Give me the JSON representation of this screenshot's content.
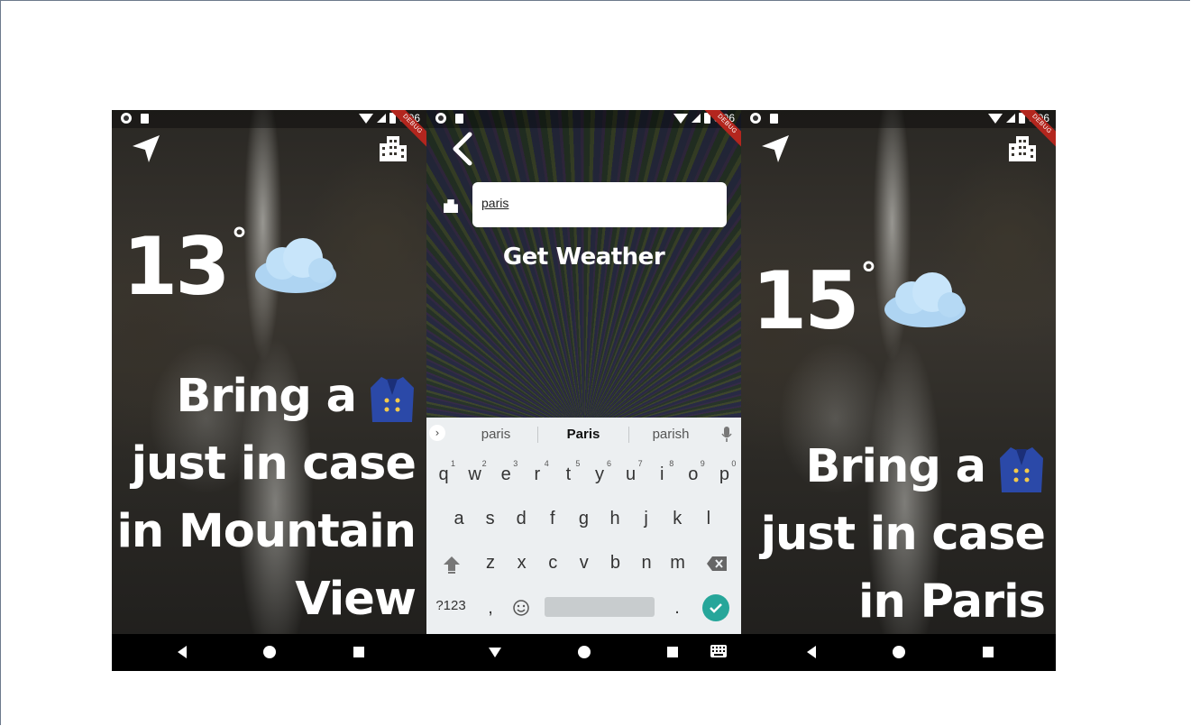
{
  "status": {
    "time": "6:06",
    "debug_label": "DEBUG"
  },
  "screens": {
    "weather_1": {
      "temperature": "13",
      "degree": "°",
      "message_lines": [
        "Bring a",
        "just in case",
        "in Mountain",
        "View"
      ]
    },
    "search": {
      "input_value": "paris",
      "button_label": "Get Weather",
      "suggestions": [
        "paris",
        "Paris",
        "parish"
      ],
      "keyboard": {
        "row1": [
          "q",
          "w",
          "e",
          "r",
          "t",
          "y",
          "u",
          "i",
          "o",
          "p"
        ],
        "row1_hints": [
          "1",
          "2",
          "3",
          "4",
          "5",
          "6",
          "7",
          "8",
          "9",
          "0"
        ],
        "row2": [
          "a",
          "s",
          "d",
          "f",
          "g",
          "h",
          "j",
          "k",
          "l"
        ],
        "row3": [
          "z",
          "x",
          "c",
          "v",
          "b",
          "n",
          "m"
        ],
        "symbols_key": "?123",
        "comma_key": ",",
        "period_key": "."
      }
    },
    "weather_3": {
      "temperature": "15",
      "degree": "°",
      "message_lines": [
        "Bring a",
        "just in case",
        "in Paris"
      ]
    }
  },
  "icons": {
    "location": "navigation-arrow-icon",
    "city": "city-buildings-icon",
    "weather": "cloud-icon",
    "clothing": "coat-icon",
    "back": "chevron-left-icon"
  },
  "colors": {
    "accent_enter": "#26a69a",
    "debug_ribbon": "#b3261e",
    "keyboard_bg": "#eceff1"
  }
}
